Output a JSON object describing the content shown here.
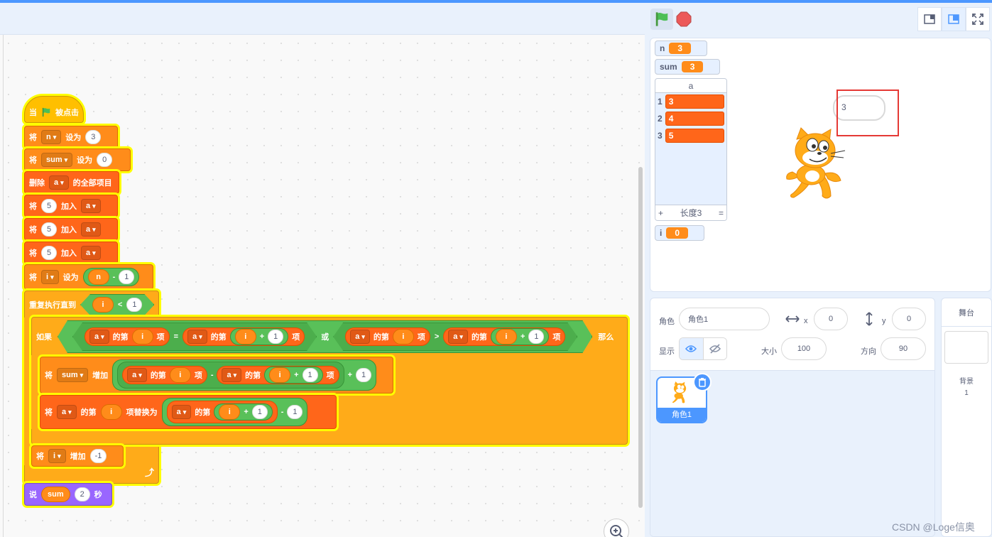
{
  "code": {
    "hat": {
      "when": "当",
      "clicked": "被点击"
    },
    "set_n": {
      "cmd": "将",
      "var": "n",
      "to": "设为",
      "value": "3"
    },
    "set_sum": {
      "cmd": "将",
      "var": "sum",
      "to": "设为",
      "value": "0"
    },
    "delete_all": {
      "cmd": "删除",
      "list": "a",
      "suffix": "的全部项目"
    },
    "add1": {
      "cmd": "将",
      "value": "5",
      "to": "加入",
      "list": "a"
    },
    "add2": {
      "cmd": "将",
      "value": "5",
      "to": "加入",
      "list": "a"
    },
    "add3": {
      "cmd": "将",
      "value": "5",
      "to": "加入",
      "list": "a"
    },
    "set_i": {
      "cmd": "将",
      "var": "i",
      "to": "设为",
      "rep": "n",
      "op": "-",
      "value": "1"
    },
    "repeat_until": {
      "label": "重复执行直到",
      "rep": "i",
      "op": "<",
      "value": "1"
    },
    "if_block": {
      "if": "如果",
      "then": "那么",
      "or": "或",
      "list": "a",
      "item_of": "的第",
      "item": "项",
      "i": "i",
      "plus": "+",
      "one": "1",
      "eq": "=",
      "gt": ">"
    },
    "change_sum": {
      "cmd": "将",
      "var": "sum",
      "by": "增加",
      "list": "a",
      "item_of": "的第",
      "i": "i",
      "item": "项",
      "minus": "-",
      "plus": "+",
      "one": "1"
    },
    "replace": {
      "cmd": "将",
      "list": "a",
      "item_of": "的第",
      "i": "i",
      "replace_with": "项替换为",
      "plus": "+",
      "one": "1",
      "minus": "-"
    },
    "change_i": {
      "cmd": "将",
      "var": "i",
      "by": "增加",
      "value": "-1"
    },
    "say": {
      "cmd": "说",
      "rep": "sum",
      "secs_value": "2",
      "secs": "秒"
    }
  },
  "stage": {
    "monitors": [
      {
        "name": "n",
        "value": "3"
      },
      {
        "name": "sum",
        "value": "3"
      },
      {
        "name": "i",
        "value": "0"
      }
    ],
    "list": {
      "name": "a",
      "items": [
        {
          "index": "1",
          "value": "3"
        },
        {
          "index": "2",
          "value": "4"
        },
        {
          "index": "3",
          "value": "5"
        }
      ],
      "add": "+",
      "length": "长度3",
      "resize": "="
    },
    "bubble": "3"
  },
  "sprite_info": {
    "sprite_label": "角色",
    "sprite_name": "角色1",
    "x_label": "x",
    "x": "0",
    "y_label": "y",
    "y": "0",
    "show_label": "显示",
    "size_label": "大小",
    "size": "100",
    "direction_label": "方向",
    "direction": "90"
  },
  "sprites": [
    {
      "name": "角色1"
    }
  ],
  "stage_panel": {
    "title": "舞台",
    "backdrop_label": "背景",
    "backdrop_count": "1"
  },
  "watermark": "CSDN @Loge信奥",
  "colors": {
    "accent": "#4c97ff",
    "events": "#ffbf00",
    "variables": "#ff8c1a",
    "lists": "#ff661a",
    "control": "#ffab19",
    "operators": "#59c059",
    "looks": "#9966ff",
    "glow": "#ffff00"
  }
}
